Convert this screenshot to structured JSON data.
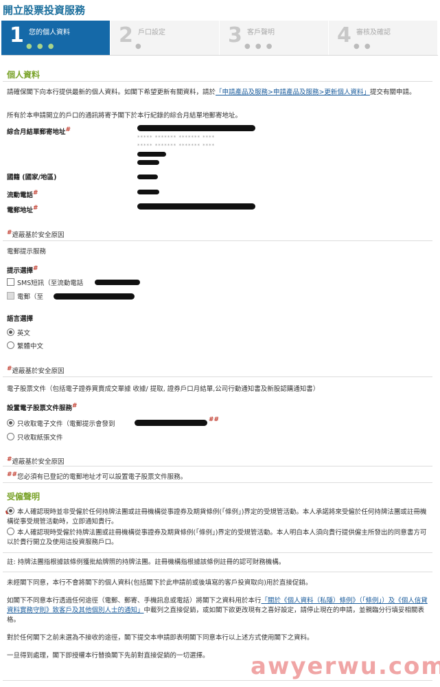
{
  "page_title": "開立股票投資服務",
  "steps": [
    {
      "num": "1",
      "label": "您的個人資料",
      "dots": "● ● ●"
    },
    {
      "num": "2",
      "label": "戶口設定",
      "dots": "●"
    },
    {
      "num": "3",
      "label": "客戶聲明",
      "dots": "● ● ●"
    },
    {
      "num": "4",
      "label": "審核及確認",
      "dots": "● ●"
    }
  ],
  "personal": {
    "heading": "個人資料",
    "intro_1": "請確保閣下向本行提供最新的個人資料。如閣下希望更新有關資料，請於",
    "intro_link": "「申請產品及服務>申請產品及服務>更新個人資料」",
    "intro_2": "提交有關申請。",
    "notice": "所有於本申請開立的戶口的通訊將寄予閣下於本行紀錄的綜合月結單地郵寄地址。",
    "address_label": "綜合月結單郵寄地址",
    "masked_line": "***** ******* ******* ****",
    "nationality_label": "國籍 (國家/地區)",
    "mobile_label": "流動電話",
    "email_label": "電郵地址",
    "hash": "#",
    "hidden_note": "遮蔽基於安全原因"
  },
  "alerts": {
    "heading": "電郵提示服務",
    "choice_label": "提示選擇",
    "sms_option": "SMS短訊（至流動電話",
    "email_option": "電郵（至",
    "lang_label": "語言選擇",
    "lang_en": "英文",
    "lang_zh": "繁體中文",
    "hidden_note": "遮蔽基於安全原因"
  },
  "estatement": {
    "heading": "電子股票文件（包括電子證券買賣成交單據 收據/ 提取, 證券戶口月結單,公司行動通知書及新股認購通知書）",
    "setting_label": "設置電子股票文件服務",
    "option_e": "只收取電子文件（電郵提示會發到",
    "option_paper": "只收取紙張文件",
    "hidden_note": "遮蔽基於安全原因",
    "double_hash": "##",
    "email_note": "您必須有已登記的電郵地址才可以設置電子股票文件服務。"
  },
  "regulated": {
    "heading": "受僱聲明",
    "option_not": "本人確認現時並非受僱於任何持牌法團或註冊機構從事證券及期貨條例(「條例」)界定的受規管活動。本人承諾將來受僱於任何持牌法團或註冊機構從事受規管活動時，立即通知貴行。",
    "option_is": "本人確認現時受僱於持牌法團或註冊機構從事證券及期貨條例(「條例」)界定的受規管活動。本人明白本人須向貴行提供僱主所發出的同意書方可以於貴行開立及使用這投資服務戶口。",
    "footnote": "註: 持牌法團指根據該條例獲批給牌照的持牌法團。註冊機構指根據該條例註冊的認可財務機構。"
  },
  "marketing": {
    "p1": "未經閣下同意，本行不會將閣下的個人資料(包括閣下於此申請前或後填寫的客戶投資取向)用於直接促銷。",
    "p2_a": "如閣下不同意本行透過任何途徑（電郵、郵寄、手機訊息或電話）將閣下之資料用於本行",
    "p2_link": "「關於《個人資料（私隱）條例》（「條例」）及《個人信貸資料實務守則》致客戶及其他個別人士的通知」",
    "p2_b": "中載列之直接促銷，或如閣下欲更改現有之喜好設定，請停止現在的申請，並親臨分行填妥相關表格。",
    "p3": "對於任何閣下之前未選為不接收的途徑，閣下提交本申請即表明閣下同意本行以上述方式使用閣下之資料。",
    "p4": "一旦得到處理，閣下即授權本行替換閣下先前對直接促銷的一切選擇。"
  },
  "watermark": "awyerwu.com",
  "colors": {
    "primary": "#1569a8",
    "section": "#7aa32a",
    "link": "#1a5c9c",
    "alert": "#c0392b"
  }
}
